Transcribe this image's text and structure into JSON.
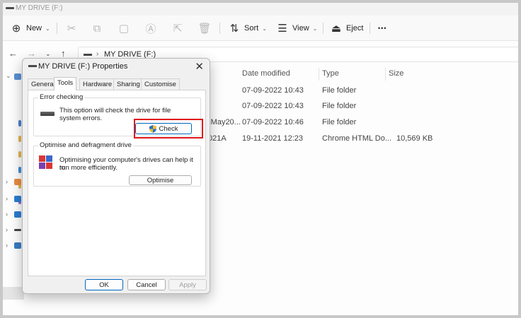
{
  "explorer": {
    "title": "MY DRIVE (F:)",
    "commands": {
      "new_label": "New",
      "sort_label": "Sort",
      "view_label": "View",
      "eject_label": "Eject",
      "more_label": "•••"
    },
    "address": {
      "crumb": "MY DRIVE (F:)"
    },
    "columns": {
      "date_modified": "Date modified",
      "type": "Type",
      "size": "Size"
    },
    "rows": [
      {
        "name": "",
        "date": "07-09-2022 10:43",
        "type": "File folder",
        "size": ""
      },
      {
        "name": "",
        "date": "07-09-2022 10:43",
        "type": "File folder",
        "size": ""
      },
      {
        "name": "-May20...",
        "date": "07-09-2022 10:46",
        "type": "File folder",
        "size": ""
      },
      {
        "name": "021A",
        "date": "19-11-2021 12:23",
        "type": "Chrome HTML Do...",
        "size": "10,569 KB"
      }
    ]
  },
  "dialog": {
    "title": "MY DRIVE (F:) Properties",
    "tabs": [
      "General",
      "Tools",
      "Hardware",
      "Sharing",
      "Customise"
    ],
    "active_tab": "Tools",
    "error_checking": {
      "label": "Error checking",
      "description_line1": "This option will check the drive for file",
      "description_line2": "system errors.",
      "button": "Check"
    },
    "optimise": {
      "label": "Optimise and defragment drive",
      "description_line1": "Optimising your computer's drives can help it to",
      "description_line2": "run more efficiently.",
      "button": "Optimise"
    },
    "footer": {
      "ok": "OK",
      "cancel": "Cancel",
      "apply": "Apply"
    }
  },
  "colors": {
    "highlight": "#e0151b",
    "accent": "#0067c0"
  }
}
